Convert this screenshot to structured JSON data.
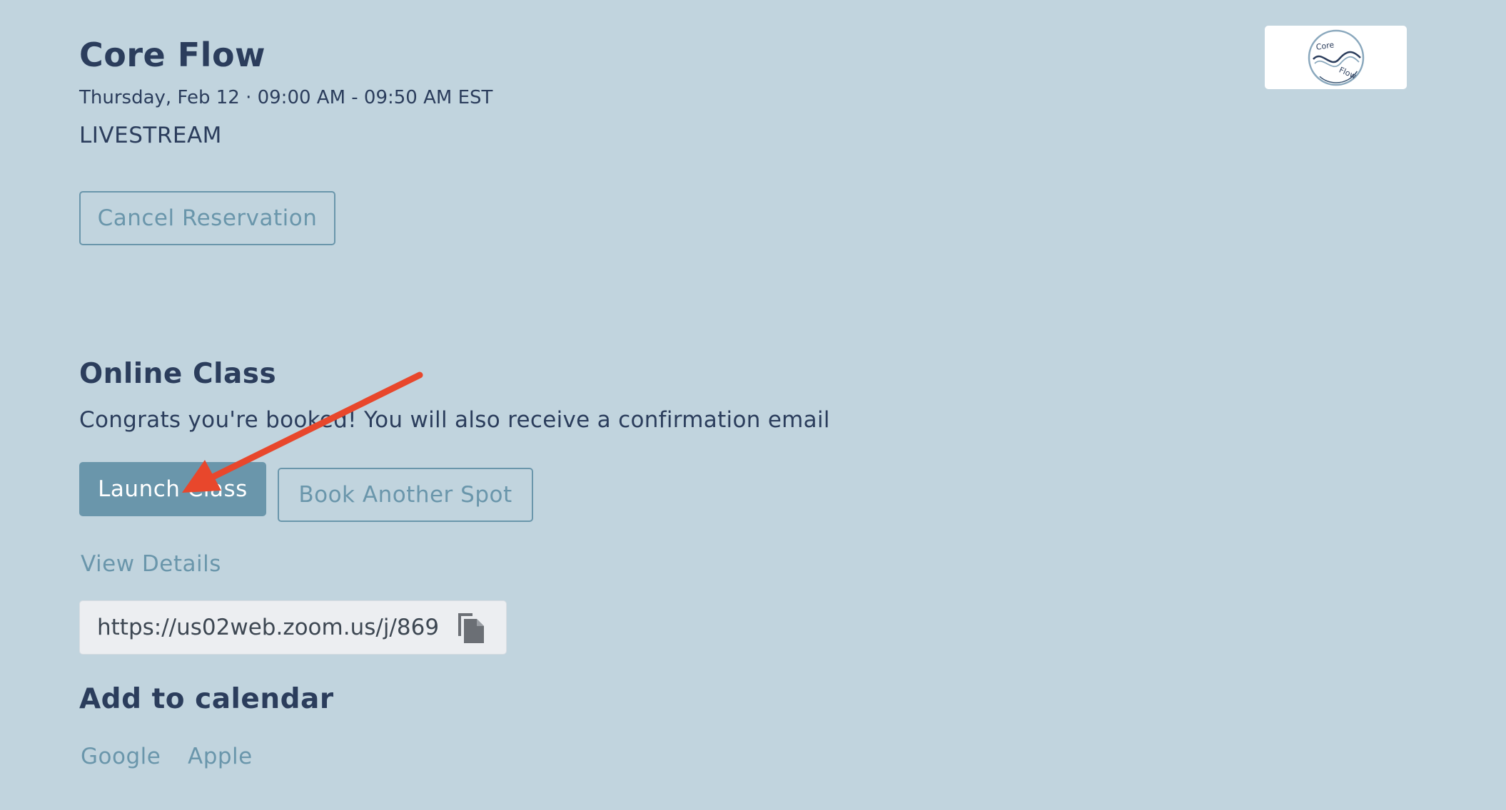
{
  "event": {
    "title": "Core Flow",
    "datetime": "Thursday, Feb 12 · 09:00 AM - 09:50 AM EST",
    "location": "LIVESTREAM",
    "cancel_label": "Cancel Reservation"
  },
  "logo": {
    "text_top": "Core",
    "text_bottom": "Flow"
  },
  "online_class": {
    "heading": "Online Class",
    "message": "Congrats you're booked! You will also receive a confirmation email",
    "launch_label": "Launch Class",
    "book_another_label": "Book Another Spot",
    "view_details_label": "View Details",
    "url_value": "https://us02web.zoom.us/j/869",
    "copy_icon": "copy-icon"
  },
  "calendar": {
    "heading": "Add to calendar",
    "google_label": "Google",
    "apple_label": "Apple"
  },
  "colors": {
    "background": "#c1d4de",
    "heading_text": "#2b3d5c",
    "accent": "#6a96ab",
    "annotation_arrow": "#e8472c"
  }
}
